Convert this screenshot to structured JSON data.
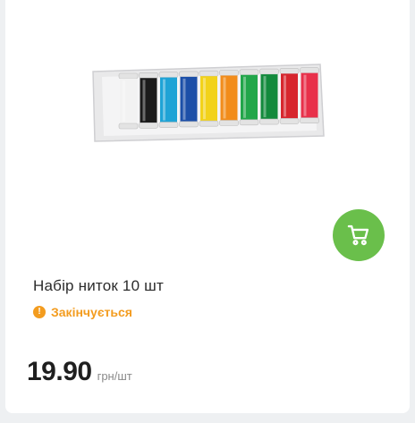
{
  "colors": {
    "accent_green": "#6abf4b",
    "warning_orange": "#f39c1f"
  },
  "product": {
    "image_icon": "thread-spools-set-image",
    "title": "Набір ниток 10 шт",
    "stock_icon": "exclamation-circle-icon",
    "stock_status": "Закінчується",
    "price": "19.90",
    "price_unit": "грн/шт"
  },
  "cart_button": {
    "icon": "shopping-cart-icon"
  }
}
